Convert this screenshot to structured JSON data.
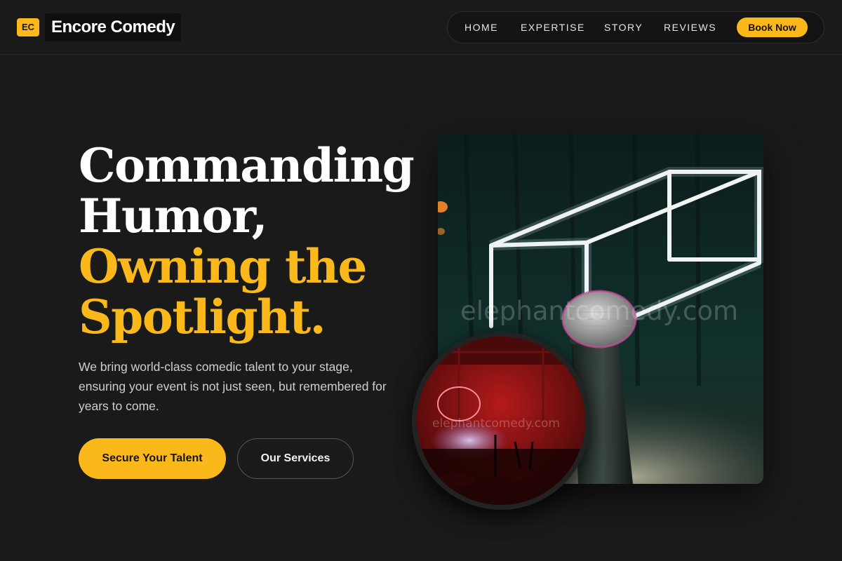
{
  "header": {
    "logo_badge": "EC",
    "brand": "Encore Comedy",
    "nav": [
      {
        "label": "HOME"
      },
      {
        "label": "EXPERTISE"
      },
      {
        "label": "STORY"
      },
      {
        "label": "REVIEWS"
      }
    ],
    "cta": "Book Now"
  },
  "hero": {
    "headline_line1": "Commanding",
    "headline_line2": "Humor,",
    "headline_line3": "Owning the",
    "headline_line4": "Spotlight.",
    "subtitle": "We bring world-class comedic talent to your stage, ensuring your event is not just seen, but remembered for years to come.",
    "primary_button": "Secure Your Talent",
    "secondary_button": "Our Services"
  },
  "images": {
    "main_watermark": "elephantcomedy.com",
    "circle_watermark": "elephantcomedy.com"
  },
  "colors": {
    "background": "#1a1a1a",
    "accent": "#fbb81b",
    "text": "#ffffff",
    "muted": "#cfcfcf"
  }
}
